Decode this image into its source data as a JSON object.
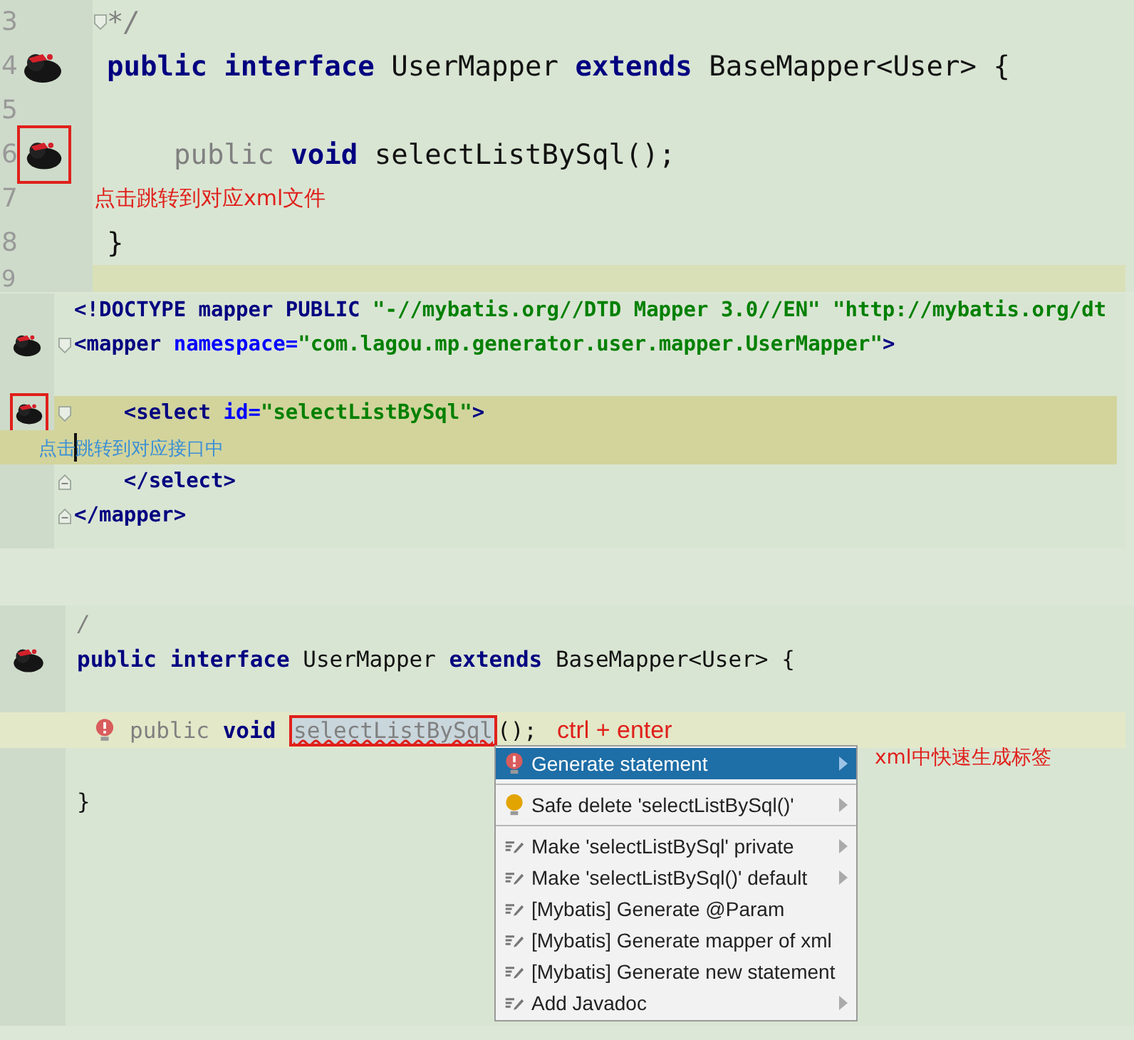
{
  "panels": [
    {
      "lines": [
        {
          "kind": "code",
          "number": "3",
          "fold_open": true,
          "segments": [
            {
              "tokens": [
                {
                  "text": "*/",
                  "kind": "comment"
                }
              ]
            }
          ]
        },
        {
          "kind": "code",
          "number": "4",
          "icon": {
            "boxed": false
          },
          "segments": [
            {
              "tokens": [
                {
                  "text": "public interface ",
                  "kind": "keyword"
                },
                {
                  "text": "UserMapper ",
                  "kind": "plain"
                },
                {
                  "text": "extends ",
                  "kind": "keyword"
                },
                {
                  "text": "BaseMapper<User> {",
                  "kind": "plain"
                }
              ]
            }
          ]
        },
        {
          "kind": "code",
          "number": "5"
        },
        {
          "kind": "code",
          "number": "6",
          "icon": {
            "boxed": true
          },
          "segments": [
            {
              "tokens": [
                {
                  "text": "    public ",
                  "kind": "unused"
                },
                {
                  "text": "void ",
                  "kind": "keyword"
                },
                {
                  "text": "selectListBySql();",
                  "kind": "plain"
                }
              ]
            }
          ]
        },
        {
          "kind": "code",
          "number": "7",
          "note": {
            "text": "点击跳转到对应xml文件",
            "color": "#e0201b"
          }
        },
        {
          "kind": "code",
          "number": "8",
          "segments": [
            {
              "tokens": [
                {
                  "text": "}",
                  "kind": "plain"
                }
              ]
            }
          ]
        },
        {
          "kind": "code",
          "number": "9",
          "highlighted": true
        }
      ]
    },
    {
      "lines": [
        {
          "kind": "code",
          "segments": [
            {
              "tokens": [
                {
                  "text": "<!DOCTYPE mapper PUBLIC ",
                  "kind": "tag"
                },
                {
                  "text": "\"-//mybatis.org//DTD Mapper 3.0//EN\" \"http://mybatis.org/dt",
                  "kind": "string"
                }
              ]
            }
          ]
        },
        {
          "kind": "code",
          "icon": {
            "boxed": false
          },
          "fold_open": true,
          "segments": [
            {
              "tokens": [
                {
                  "text": "<mapper ",
                  "kind": "tag"
                },
                {
                  "text": "namespace=",
                  "kind": "attr"
                },
                {
                  "text": "\"com.lagou.mp.generator.user.mapper.UserMapper\"",
                  "kind": "string"
                },
                {
                  "text": ">",
                  "kind": "tag"
                }
              ]
            }
          ]
        },
        {
          "kind": "blank"
        },
        {
          "kind": "code",
          "icon": {
            "boxed": true
          },
          "fold_open": true,
          "highlighted": true,
          "segments": [
            {
              "tokens": [
                {
                  "text": "    <select ",
                  "kind": "tag"
                },
                {
                  "text": "id=",
                  "kind": "attr"
                },
                {
                  "text": "\"selectListBySql\"",
                  "kind": "string"
                },
                {
                  "text": ">",
                  "kind": "tag"
                }
              ]
            }
          ]
        },
        {
          "kind": "code",
          "highlighted": true,
          "cursor": true,
          "note": {
            "text": "点击跳转到对应接口中",
            "color": "#3a8fd6"
          }
        },
        {
          "kind": "code",
          "fold_close": true,
          "segments": [
            {
              "tokens": [
                {
                  "text": "    </select>",
                  "kind": "tag"
                }
              ]
            }
          ]
        },
        {
          "kind": "code",
          "fold_close": true,
          "segments": [
            {
              "tokens": [
                {
                  "text": "</mapper>",
                  "kind": "tag"
                }
              ]
            }
          ]
        }
      ]
    },
    {
      "lines": [
        {
          "kind": "code",
          "segments": [
            {
              "tokens": [
                {
                  "text": "/",
                  "kind": "comment"
                }
              ]
            }
          ]
        },
        {
          "kind": "code",
          "icon": {
            "boxed": false
          },
          "segments": [
            {
              "tokens": [
                {
                  "text": "public interface ",
                  "kind": "keyword"
                },
                {
                  "text": "UserMapper ",
                  "kind": "plain"
                },
                {
                  "text": "extends ",
                  "kind": "keyword"
                },
                {
                  "text": "BaseMapper<User> {",
                  "kind": "plain"
                }
              ]
            }
          ]
        },
        {
          "kind": "blank"
        },
        {
          "kind": "code",
          "highlighted": true,
          "error": true,
          "segments": [
            {
              "tokens": [
                {
                  "text": "public ",
                  "kind": "unused"
                },
                {
                  "text": "void ",
                  "kind": "keyword"
                }
              ]
            },
            {
              "framed": true,
              "tokens": [
                {
                  "text": "selectListBySql",
                  "kind": "unused"
                }
              ]
            },
            {
              "tokens": [
                {
                  "text": "();",
                  "kind": "plain"
                }
              ]
            }
          ],
          "note": {
            "text": "ctrl + enter",
            "color": "#e0201b"
          }
        },
        {
          "kind": "blank"
        },
        {
          "kind": "code",
          "segments": [
            {
              "tokens": [
                {
                  "text": "}",
                  "kind": "plain"
                }
              ]
            }
          ]
        }
      ],
      "popup": {
        "items": [
          {
            "label": "Generate statement",
            "kind": "error",
            "selected": true,
            "submenu": true,
            "separator_after": true
          },
          {
            "label": "Safe delete 'selectListBySql()'",
            "kind": "bulb",
            "selected": false,
            "submenu": true,
            "separator_after": true
          },
          {
            "label": "Make 'selectListBySql' private",
            "kind": "edit",
            "selected": false,
            "submenu": true,
            "separator_after": false
          },
          {
            "label": "Make 'selectListBySql()' default",
            "kind": "edit",
            "selected": false,
            "submenu": true,
            "separator_after": false
          },
          {
            "label": "[Mybatis] Generate @Param",
            "kind": "edit",
            "selected": false,
            "submenu": false,
            "separator_after": false
          },
          {
            "label": "[Mybatis] Generate mapper of xml",
            "kind": "edit",
            "selected": false,
            "submenu": false,
            "separator_after": false
          },
          {
            "label": "[Mybatis] Generate new statement",
            "kind": "edit",
            "selected": false,
            "submenu": false,
            "separator_after": false
          },
          {
            "label": "Add Javadoc",
            "kind": "edit",
            "selected": false,
            "submenu": true,
            "separator_after": false
          }
        ],
        "note": {
          "text": "xml中快速生成标签",
          "color": "#e0201b"
        }
      }
    }
  ]
}
